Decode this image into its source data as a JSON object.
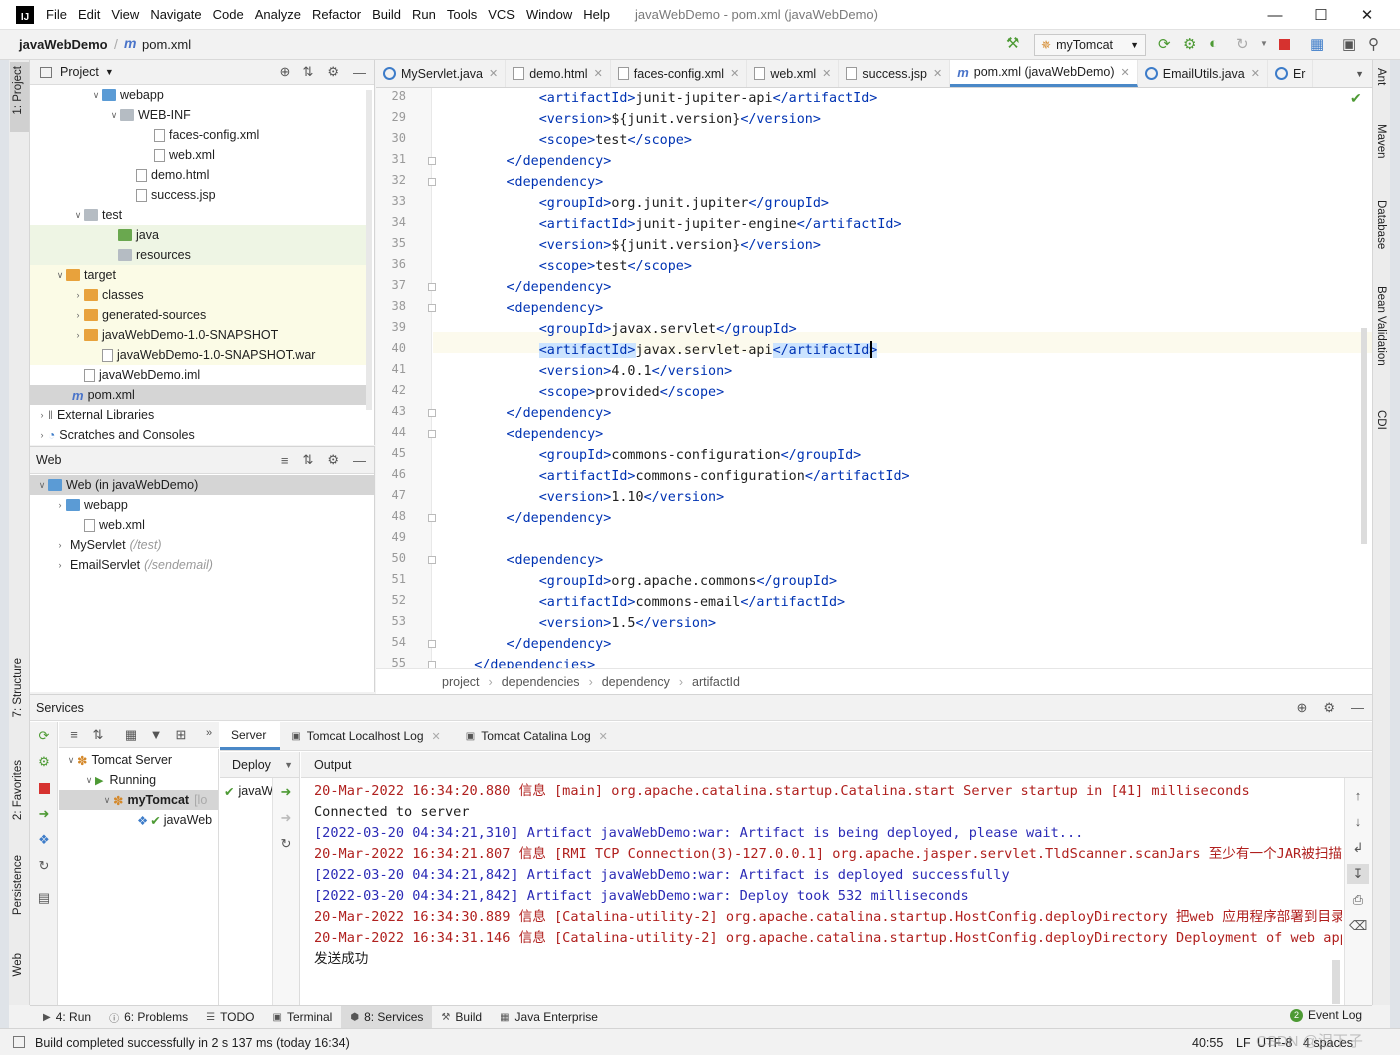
{
  "app": {
    "title": "javaWebDemo - pom.xml (javaWebDemo)",
    "menu": [
      "File",
      "Edit",
      "View",
      "Navigate",
      "Code",
      "Analyze",
      "Refactor",
      "Build",
      "Run",
      "Tools",
      "VCS",
      "Window",
      "Help"
    ]
  },
  "navbar": {
    "project": "javaWebDemo",
    "file": "pom.xml",
    "run_config": "myTomcat"
  },
  "left_strip": [
    "1: Project",
    "7: Structure",
    "2: Favorites",
    "Persistence",
    "Web"
  ],
  "right_strip": [
    "Ant",
    "Maven",
    "Database",
    "Bean Validation",
    "CDI"
  ],
  "project_panel": {
    "header": "Project",
    "tree": [
      {
        "label": "webapp",
        "suffix": ""
      },
      {
        "label": "WEB-INF",
        "suffix": ""
      },
      {
        "label": "faces-config.xml",
        "suffix": ""
      },
      {
        "label": "web.xml",
        "suffix": ""
      },
      {
        "label": "demo.html",
        "suffix": ""
      },
      {
        "label": "success.jsp",
        "suffix": ""
      },
      {
        "label": "test",
        "suffix": ""
      },
      {
        "label": "java",
        "suffix": ""
      },
      {
        "label": "resources",
        "suffix": ""
      },
      {
        "label": "target",
        "suffix": ""
      },
      {
        "label": "classes",
        "suffix": ""
      },
      {
        "label": "generated-sources",
        "suffix": ""
      },
      {
        "label": "javaWebDemo-1.0-SNAPSHOT",
        "suffix": ""
      },
      {
        "label": "javaWebDemo-1.0-SNAPSHOT.war",
        "suffix": ""
      },
      {
        "label": "javaWebDemo.iml",
        "suffix": ""
      },
      {
        "label": "pom.xml",
        "suffix": ""
      },
      {
        "label": "External Libraries",
        "suffix": ""
      },
      {
        "label": "Scratches and Consoles",
        "suffix": ""
      }
    ]
  },
  "web_panel": {
    "header": "Web",
    "tree": [
      {
        "label": "Web (in javaWebDemo)",
        "suffix": ""
      },
      {
        "label": "webapp",
        "suffix": ""
      },
      {
        "label": "web.xml",
        "suffix": ""
      },
      {
        "label": "MyServlet",
        "suffix": "(/test)"
      },
      {
        "label": "EmailServlet",
        "suffix": "(/sendemail)"
      }
    ]
  },
  "editor_tabs": [
    "MyServlet.java",
    "demo.html",
    "faces-config.xml",
    "web.xml",
    "success.jsp",
    "pom.xml (javaWebDemo)",
    "EmailUtils.java",
    "Er"
  ],
  "code_lines": [
    {
      "n": "28",
      "i": "            ",
      "t": [
        [
          "tg",
          "<artifactId>"
        ],
        [
          "tx",
          "junit-jupiter-api"
        ],
        [
          "tg",
          "</artifactId>"
        ]
      ]
    },
    {
      "n": "29",
      "i": "            ",
      "t": [
        [
          "tg",
          "<version>"
        ],
        [
          "tx",
          "${junit.version}"
        ],
        [
          "tg",
          "</version>"
        ]
      ]
    },
    {
      "n": "30",
      "i": "            ",
      "t": [
        [
          "tg",
          "<scope>"
        ],
        [
          "tx",
          "test"
        ],
        [
          "tg",
          "</scope>"
        ]
      ]
    },
    {
      "n": "31",
      "i": "        ",
      "t": [
        [
          "tg",
          "</dependency>"
        ]
      ]
    },
    {
      "n": "32",
      "i": "        ",
      "t": [
        [
          "tg",
          "<dependency>"
        ]
      ]
    },
    {
      "n": "33",
      "i": "            ",
      "t": [
        [
          "tg",
          "<groupId>"
        ],
        [
          "tx",
          "org.junit.jupiter"
        ],
        [
          "tg",
          "</groupId>"
        ]
      ]
    },
    {
      "n": "34",
      "i": "            ",
      "t": [
        [
          "tg",
          "<artifactId>"
        ],
        [
          "tx",
          "junit-jupiter-engine"
        ],
        [
          "tg",
          "</artifactId>"
        ]
      ]
    },
    {
      "n": "35",
      "i": "            ",
      "t": [
        [
          "tg",
          "<version>"
        ],
        [
          "tx",
          "${junit.version}"
        ],
        [
          "tg",
          "</version>"
        ]
      ]
    },
    {
      "n": "36",
      "i": "            ",
      "t": [
        [
          "tg",
          "<scope>"
        ],
        [
          "tx",
          "test"
        ],
        [
          "tg",
          "</scope>"
        ]
      ]
    },
    {
      "n": "37",
      "i": "        ",
      "t": [
        [
          "tg",
          "</dependency>"
        ]
      ]
    },
    {
      "n": "38",
      "i": "        ",
      "t": [
        [
          "tg",
          "<dependency>"
        ]
      ]
    },
    {
      "n": "39",
      "i": "            ",
      "t": [
        [
          "tg",
          "<groupId>"
        ],
        [
          "tx",
          "javax.servlet"
        ],
        [
          "tg",
          "</groupId>"
        ]
      ]
    },
    {
      "n": "40",
      "i": "            ",
      "t": [
        [
          "tg",
          "<artifactId>"
        ],
        [
          "tx",
          "javax.servlet-api"
        ],
        [
          "tg",
          "</artifactId>"
        ]
      ]
    },
    {
      "n": "41",
      "i": "            ",
      "t": [
        [
          "tg",
          "<version>"
        ],
        [
          "tx",
          "4.0.1"
        ],
        [
          "tg",
          "</version>"
        ]
      ]
    },
    {
      "n": "42",
      "i": "            ",
      "t": [
        [
          "tg",
          "<scope>"
        ],
        [
          "tx",
          "provided"
        ],
        [
          "tg",
          "</scope>"
        ]
      ]
    },
    {
      "n": "43",
      "i": "        ",
      "t": [
        [
          "tg",
          "</dependency>"
        ]
      ]
    },
    {
      "n": "44",
      "i": "        ",
      "t": [
        [
          "tg",
          "<dependency>"
        ]
      ]
    },
    {
      "n": "45",
      "i": "            ",
      "t": [
        [
          "tg",
          "<groupId>"
        ],
        [
          "tx",
          "commons-configuration"
        ],
        [
          "tg",
          "</groupId>"
        ]
      ]
    },
    {
      "n": "46",
      "i": "            ",
      "t": [
        [
          "tg",
          "<artifactId>"
        ],
        [
          "tx",
          "commons-configuration"
        ],
        [
          "tg",
          "</artifactId>"
        ]
      ]
    },
    {
      "n": "47",
      "i": "            ",
      "t": [
        [
          "tg",
          "<version>"
        ],
        [
          "tx",
          "1.10"
        ],
        [
          "tg",
          "</version>"
        ]
      ]
    },
    {
      "n": "48",
      "i": "        ",
      "t": [
        [
          "tg",
          "</dependency>"
        ]
      ]
    },
    {
      "n": "49",
      "i": "",
      "t": []
    },
    {
      "n": "50",
      "i": "        ",
      "t": [
        [
          "tg",
          "<dependency>"
        ]
      ]
    },
    {
      "n": "51",
      "i": "            ",
      "t": [
        [
          "tg",
          "<groupId>"
        ],
        [
          "tx",
          "org.apache.commons"
        ],
        [
          "tg",
          "</groupId>"
        ]
      ]
    },
    {
      "n": "52",
      "i": "            ",
      "t": [
        [
          "tg",
          "<artifactId>"
        ],
        [
          "tx",
          "commons-email"
        ],
        [
          "tg",
          "</artifactId>"
        ]
      ]
    },
    {
      "n": "53",
      "i": "            ",
      "t": [
        [
          "tg",
          "<version>"
        ],
        [
          "tx",
          "1.5"
        ],
        [
          "tg",
          "</version>"
        ]
      ]
    },
    {
      "n": "54",
      "i": "        ",
      "t": [
        [
          "tg",
          "</dependency>"
        ]
      ]
    },
    {
      "n": "55",
      "i": "    ",
      "t": [
        [
          "tg",
          "</dependencies>"
        ]
      ]
    }
  ],
  "breadcrumb": [
    "project",
    "dependencies",
    "dependency",
    "artifactId"
  ],
  "services": {
    "header": "Services",
    "tree": [
      "Tomcat Server",
      "Running",
      "myTomcat",
      "javaWeb"
    ],
    "tree_suffix": "[lo",
    "tabs": [
      "Server",
      "Tomcat Localhost Log",
      "Tomcat Catalina Log"
    ],
    "deploy_label": "Deploy",
    "deploy_item": "javaW",
    "output_label": "Output",
    "output": [
      {
        "c": "red",
        "t": "20-Mar-2022 16:34:20.880 信息 [main] org.apache.catalina.startup.Catalina.start Server startup in [41] milliseconds"
      },
      {
        "c": "blk",
        "t": "Connected to server"
      },
      {
        "c": "blue",
        "t": "[2022-03-20 04:34:21,310] Artifact javaWebDemo:war: Artifact is being deployed, please wait..."
      },
      {
        "c": "red",
        "t": "20-Mar-2022 16:34:21.807 信息 [RMI TCP Connection(3)-127.0.0.1] org.apache.jasper.servlet.TldScanner.scanJars 至少有一个JAR被扫描用于"
      },
      {
        "c": "blue",
        "t": "[2022-03-20 04:34:21,842] Artifact javaWebDemo:war: Artifact is deployed successfully"
      },
      {
        "c": "blue",
        "t": "[2022-03-20 04:34:21,842] Artifact javaWebDemo:war: Deploy took 532 milliseconds"
      },
      {
        "c": "red",
        "t": "20-Mar-2022 16:34:30.889 信息 [Catalina-utility-2] org.apache.catalina.startup.HostConfig.deployDirectory 把web 应用程序部署到目录 [D"
      },
      {
        "c": "red",
        "t": "20-Mar-2022 16:34:31.146 信息 [Catalina-utility-2] org.apache.catalina.startup.HostConfig.deployDirectory Deployment of web appli"
      },
      {
        "c": "blk",
        "t": "发送成功"
      }
    ]
  },
  "bottom_tabs": [
    {
      "label": "4: Run"
    },
    {
      "label": "6: Problems"
    },
    {
      "label": "TODO"
    },
    {
      "label": "Terminal"
    },
    {
      "label": "8: Services"
    },
    {
      "label": "Build"
    },
    {
      "label": "Java Enterprise"
    }
  ],
  "event_log": {
    "label": "Event Log",
    "count": "2"
  },
  "status": {
    "message": "Build completed successfully in 2 s 137 ms (today 16:34)",
    "position": "40:55",
    "line_sep": "LF",
    "encoding": "UTF-8",
    "indent": "4 spaces",
    "watermark": "CSDN @泪下子"
  }
}
